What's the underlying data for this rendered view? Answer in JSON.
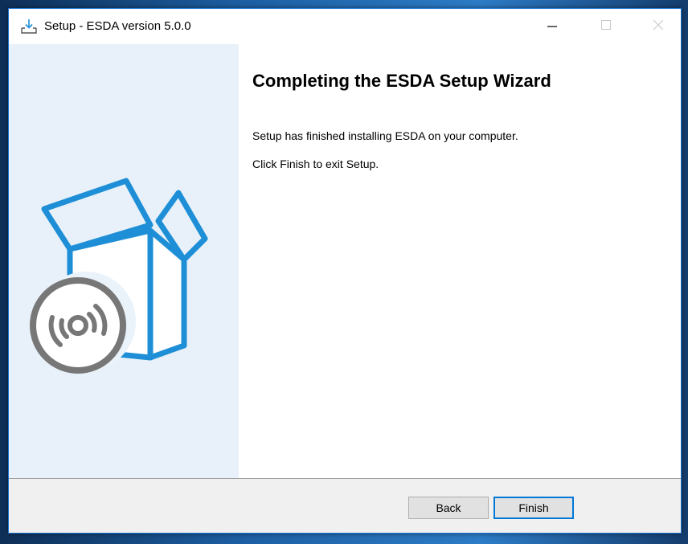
{
  "window": {
    "title": "Setup - ESDA version 5.0.0",
    "icon": "download-tray-icon",
    "controls": {
      "minimize": "minimize-icon",
      "maximize": "maximize-icon",
      "close": "close-icon"
    }
  },
  "sidebar": {
    "illustration": "software-box-with-disc"
  },
  "content": {
    "heading": "Completing the ESDA Setup Wizard",
    "paragraphs": [
      "Setup has finished installing ESDA on your computer.",
      "Click Finish to exit Setup."
    ]
  },
  "footer": {
    "back_label": "Back",
    "finish_label": "Finish"
  },
  "colors": {
    "accent": "#0078d7",
    "sidebar_bg": "#e8f1f9",
    "art_blue": "#1e8fd6",
    "art_gray": "#777777"
  }
}
